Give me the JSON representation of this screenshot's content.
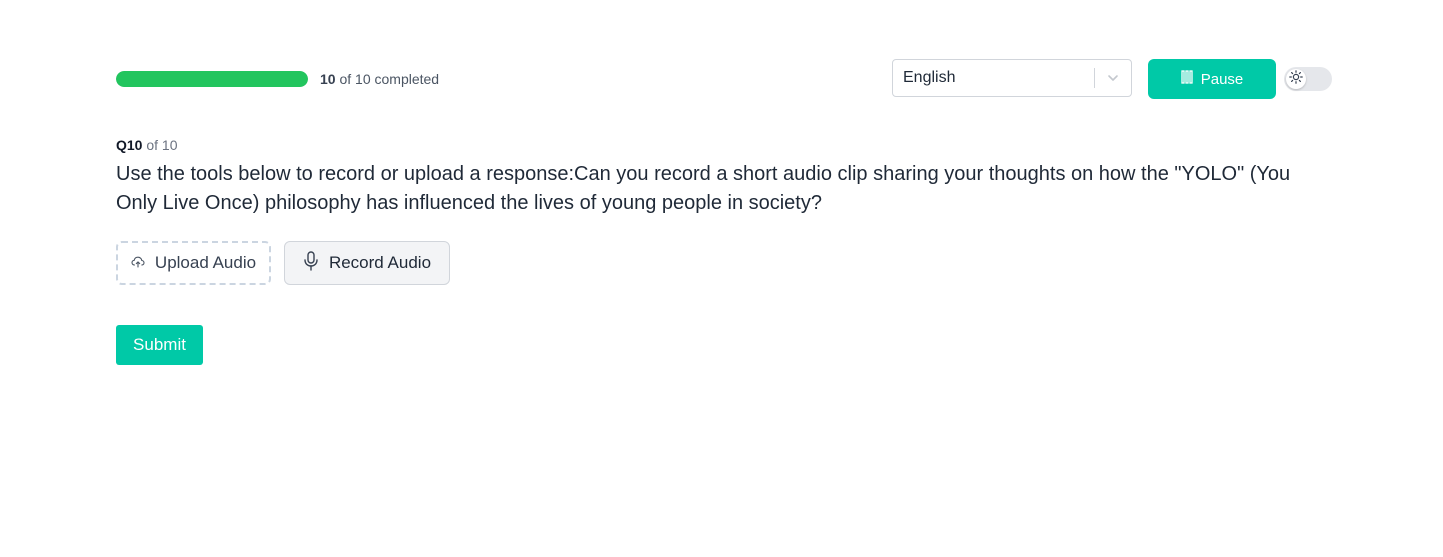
{
  "progress": {
    "fraction": 1.0,
    "completed": "10",
    "suffix": "of 10 completed"
  },
  "language": {
    "selected": "English"
  },
  "controls": {
    "pause_label": "Pause",
    "pause_icon": "pause-icon",
    "theme_icon": "sun-icon"
  },
  "question": {
    "number": "Q10",
    "of_total": "of 10",
    "text": "Use the tools below to record or upload a response:Can you record a short audio clip sharing your thoughts on how the \"YOLO\" (You Only Live Once) philosophy has influenced the lives of young people in society?"
  },
  "actions": {
    "upload_label": "Upload Audio",
    "upload_icon": "cloud-upload-icon",
    "record_label": "Record Audio",
    "record_icon": "microphone-icon"
  },
  "submit": {
    "label": "Submit"
  },
  "colors": {
    "accent": "#00c9a7",
    "progress": "#22c55e"
  }
}
